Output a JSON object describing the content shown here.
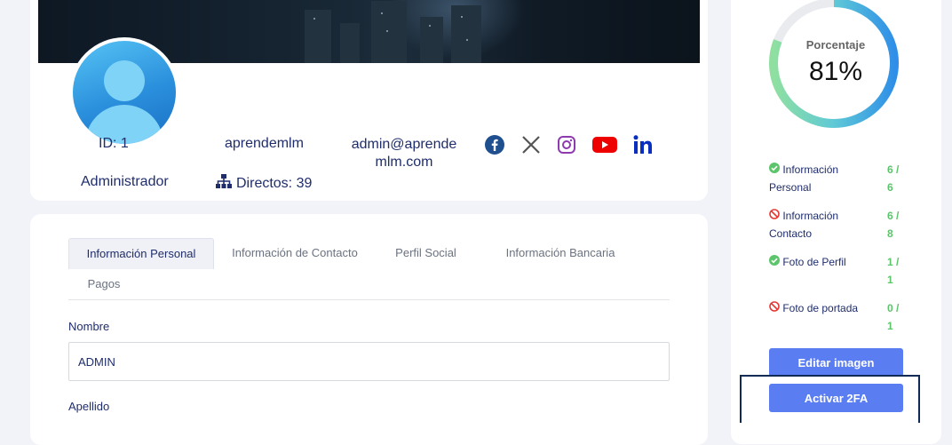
{
  "profile": {
    "id_label": "ID: 1",
    "username": "aprendemlm",
    "email_line1": "admin@aprende",
    "email_line2": "mlm.com",
    "role": "Administrador",
    "directos_label": "Directos: 39",
    "social_icons": [
      "facebook-icon",
      "x-twitter-icon",
      "instagram-icon",
      "youtube-icon",
      "linkedin-icon"
    ]
  },
  "tabs": [
    {
      "label": "Información Personal",
      "active": true
    },
    {
      "label": "Información de Contacto",
      "active": false
    },
    {
      "label": "Perfil Social",
      "active": false
    },
    {
      "label": "Información Bancaria",
      "active": false
    },
    {
      "label": "Pagos",
      "active": false
    }
  ],
  "form": {
    "nombre_label": "Nombre",
    "nombre_value": "ADMIN",
    "apellido_label": "Apellido"
  },
  "completion": {
    "title": "Porcentaje",
    "percent_text": "81%",
    "percent_value": 81,
    "items": [
      {
        "label_1": "Información",
        "label_2": "Personal",
        "status": "complete",
        "count_1": "6 /",
        "count_2": "6"
      },
      {
        "label_1": "Información",
        "label_2": "Contacto",
        "status": "incomplete",
        "count_1": "6 /",
        "count_2": "8"
      },
      {
        "label_1": "Foto de Perfil",
        "label_2": "",
        "status": "complete",
        "count_1": "1 /",
        "count_2": "1"
      },
      {
        "label_1": "Foto de portada",
        "label_2": "",
        "status": "incomplete",
        "count_1": "0 /",
        "count_2": "1"
      }
    ],
    "edit_image_label": "Editar imagen",
    "activate_2fa_label": "Activar 2FA"
  },
  "colors": {
    "accent": "#5b7df2",
    "ok": "#5cc46a",
    "error": "#e53935",
    "text": "#1f2d6b"
  }
}
